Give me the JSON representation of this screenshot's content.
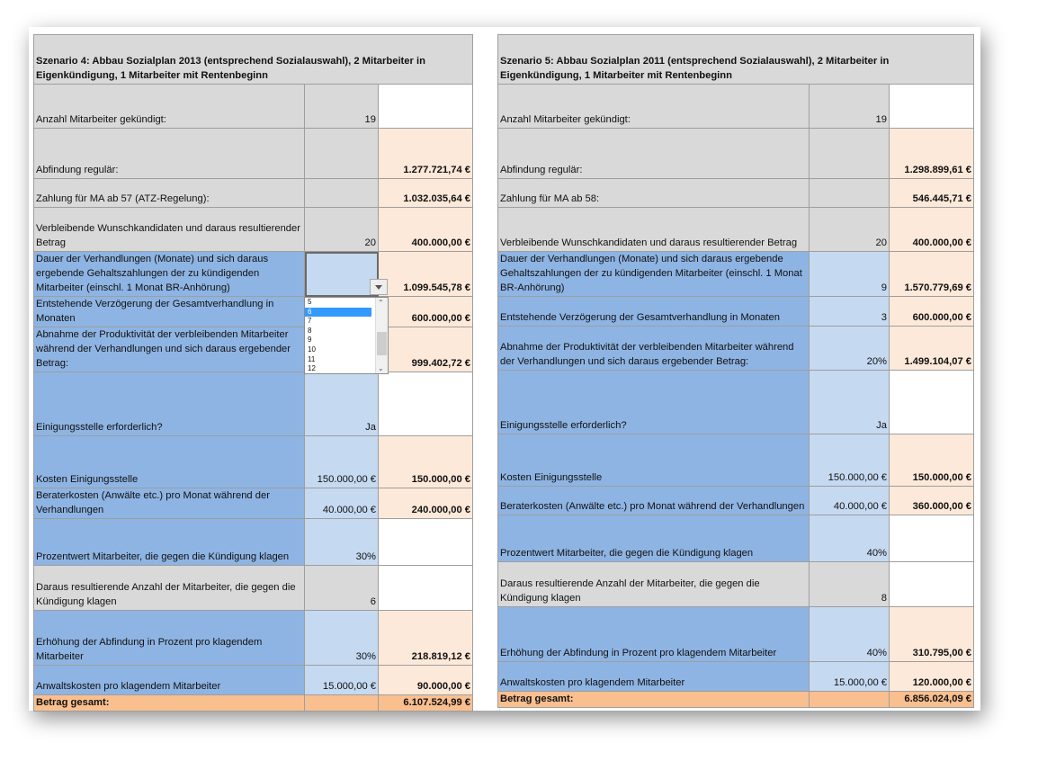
{
  "left": {
    "title": "Szenario 4: Abbau Sozialplan 2013 (entsprechend Sozialauswahl), 2 Mitarbeiter in Eigenkündigung, 1 Mitarbeiter mit Rentenbeginn",
    "rows": [
      {
        "label": "Anzahl Mitarbeiter gekündigt:",
        "value": "19",
        "amount": ""
      },
      {
        "label": "Abfindung regulär:",
        "value": "",
        "amount": "1.277.721,74 €"
      },
      {
        "label": "Zahlung für MA ab 57 (ATZ-Regelung):",
        "value": "",
        "amount": "1.032.035,64 €"
      },
      {
        "label": "Verbleibende Wunschkandidaten und daraus resultierender Betrag",
        "value": "20",
        "amount": "400.000,00 €"
      },
      {
        "label": "Dauer der Verhandlungen (Monate) und sich daraus ergebende Gehaltszahlungen der zu kündigenden Mitarbeiter (einschl. 1 Monat BR-Anhörung)",
        "value": "",
        "amount": "1.099.545,78 €"
      },
      {
        "label": "Entstehende Verzögerung der Gesamtverhandlung in Monaten",
        "value": "",
        "amount": "600.000,00 €"
      },
      {
        "label": "Abnahme der Produktivität der verbleibenden Mitarbeiter während der Verhandlungen und sich daraus ergebender Betrag:",
        "value": "",
        "amount": "999.402,72 €"
      },
      {
        "label": "Einigungsstelle erforderlich?",
        "value": "Ja",
        "amount": ""
      },
      {
        "label": "Kosten Einigungsstelle",
        "value": "150.000,00 €",
        "amount": "150.000,00 €"
      },
      {
        "label": "Beraterkosten (Anwälte etc.) pro Monat während der Verhandlungen",
        "value": "40.000,00 €",
        "amount": "240.000,00 €"
      },
      {
        "label": "Prozentwert Mitarbeiter, die gegen die Kündigung klagen",
        "value": "30%",
        "amount": ""
      },
      {
        "label": "Daraus resultierende Anzahl der Mitarbeiter, die gegen die Kündigung klagen",
        "value": "6",
        "amount": ""
      },
      {
        "label": "Erhöhung der Abfindung in Prozent pro klagendem Mitarbeiter",
        "value": "30%",
        "amount": "218.819,12 €"
      },
      {
        "label": "Anwaltskosten pro klagendem Mitarbeiter",
        "value": "15.000,00 €",
        "amount": "90.000,00 €"
      }
    ],
    "total_label": "Betrag gesamt:",
    "total_amount": "6.107.524,99 €"
  },
  "right": {
    "title": "Szenario 5: Abbau Sozialplan 2011 (entsprechend Sozialauswahl), 2 Mitarbeiter in Eigenkündigung, 1 Mitarbeiter mit Rentenbeginn",
    "rows": [
      {
        "label": "Anzahl Mitarbeiter gekündigt:",
        "value": "19",
        "amount": ""
      },
      {
        "label": "Abfindung regulär:",
        "value": "",
        "amount": "1.298.899,61 €"
      },
      {
        "label": "Zahlung für MA ab 58:",
        "value": "",
        "amount": "546.445,71 €"
      },
      {
        "label": "Verbleibende Wunschkandidaten und daraus resultierender Betrag",
        "value": "20",
        "amount": "400.000,00 €"
      },
      {
        "label": "Dauer der Verhandlungen (Monate) und sich daraus ergebende Gehaltszahlungen der zu kündigenden Mitarbeiter (einschl. 1 Monat BR-Anhörung)",
        "value": "9",
        "amount": "1.570.779,69 €"
      },
      {
        "label": "Entstehende Verzögerung der Gesamtverhandlung in Monaten",
        "value": "3",
        "amount": "600.000,00 €"
      },
      {
        "label": "Abnahme der Produktivität der verbleibenden Mitarbeiter während der Verhandlungen und sich daraus ergebender Betrag:",
        "value": "20%",
        "amount": "1.499.104,07 €"
      },
      {
        "label": "Einigungsstelle erforderlich?",
        "value": "Ja",
        "amount": ""
      },
      {
        "label": "Kosten Einigungsstelle",
        "value": "150.000,00 €",
        "amount": "150.000,00 €"
      },
      {
        "label": "Beraterkosten (Anwälte etc.) pro Monat während der Verhandlungen",
        "value": "40.000,00 €",
        "amount": "360.000,00 €"
      },
      {
        "label": "Prozentwert Mitarbeiter, die gegen die Kündigung klagen",
        "value": "40%",
        "amount": ""
      },
      {
        "label": "Daraus resultierende Anzahl der Mitarbeiter, die gegen die Kündigung klagen",
        "value": "8",
        "amount": ""
      },
      {
        "label": "Erhöhung der Abfindung in Prozent pro klagendem Mitarbeiter",
        "value": "40%",
        "amount": "310.795,00 €"
      },
      {
        "label": "Anwaltskosten pro klagendem Mitarbeiter",
        "value": "15.000,00 €",
        "amount": "120.000,00 €"
      }
    ],
    "total_label": "Betrag gesamt:",
    "total_amount": "6.856.024,09 €"
  },
  "dropdown": {
    "options": [
      "5",
      "6",
      "7",
      "8",
      "9",
      "10",
      "11",
      "12"
    ],
    "selected": "6"
  }
}
